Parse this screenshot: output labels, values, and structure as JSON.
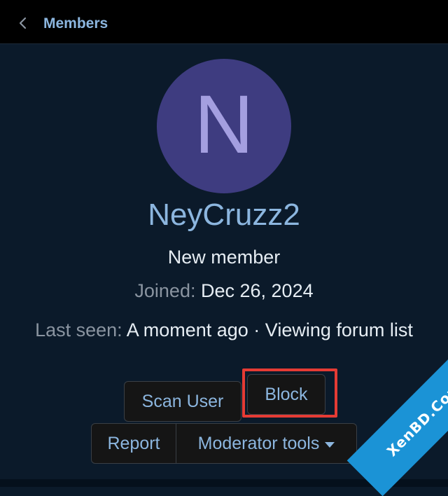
{
  "header": {
    "back_label": "Members"
  },
  "profile": {
    "avatar_letter": "N",
    "avatar_bg": "#3e3c80",
    "username": "NeyCruzz2",
    "role": "New member",
    "joined_label": "Joined:",
    "joined_value": "Dec 26, 2024",
    "lastseen_label": "Last seen:",
    "lastseen_value": "A moment ago · Viewing forum list"
  },
  "actions": {
    "scan_user": "Scan User",
    "block": "Block",
    "report": "Report",
    "moderator_tools": "Moderator tools"
  },
  "watermark": {
    "text": "XenBD.Com"
  },
  "colors": {
    "accent": "#8cb6df",
    "highlight": "#e53b34",
    "watermark_bg": "#1b93d6"
  }
}
